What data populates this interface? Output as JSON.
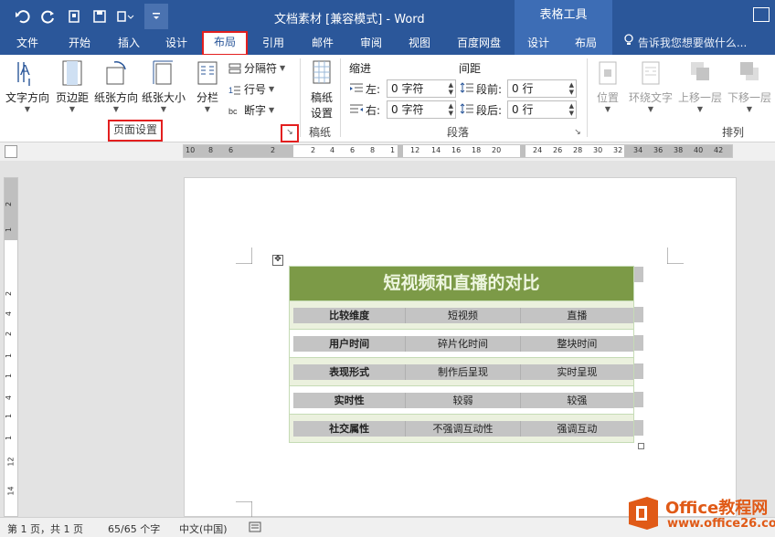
{
  "titlebar": {
    "title": "文档素材 [兼容模式] - Word",
    "context_tab_group": "表格工具",
    "qat_more": "="
  },
  "tabs": [
    {
      "label": "文件",
      "active": false
    },
    {
      "label": "开始",
      "active": false
    },
    {
      "label": "插入",
      "active": false
    },
    {
      "label": "设计",
      "active": false
    },
    {
      "label": "布局",
      "active": true
    },
    {
      "label": "引用",
      "active": false
    },
    {
      "label": "邮件",
      "active": false
    },
    {
      "label": "审阅",
      "active": false
    },
    {
      "label": "视图",
      "active": false
    },
    {
      "label": "百度网盘",
      "active": false
    },
    {
      "label": "设计",
      "active": false
    },
    {
      "label": "布局",
      "active": false
    }
  ],
  "tellme": "告诉我您想要做什么...",
  "ribbon": {
    "page_setup": {
      "text_direction": "文字方向",
      "margins": "页边距",
      "orientation": "纸张方向",
      "size": "纸张大小",
      "columns": "分栏",
      "breaks": "分隔符",
      "line_numbers": "行号",
      "hyphenation": "断字",
      "label": "页面设置",
      "launcher": "↘"
    },
    "manuscript": {
      "button_line1": "稿纸",
      "button_line2": "设置",
      "label": "稿纸"
    },
    "paragraph": {
      "indent_title": "缩进",
      "spacing_title": "间距",
      "left_label": "左:",
      "right_label": "右:",
      "before_label": "段前:",
      "after_label": "段后:",
      "left_value": "0 字符",
      "right_value": "0 字符",
      "before_value": "0 行",
      "after_value": "0 行",
      "label": "段落"
    },
    "arrange": {
      "position": "位置",
      "wrap_text": "环绕文字",
      "bring_forward": "上移一层",
      "send_backward": "下移一层",
      "label": "排列"
    }
  },
  "hruler_ticks": [
    "10",
    "8",
    "6",
    "2",
    "2",
    "4",
    "6",
    "8",
    "1",
    "12",
    "14",
    "16",
    "18",
    "20",
    "24",
    "26",
    "28",
    "30",
    "32",
    "34",
    "36",
    "38",
    "40",
    "42"
  ],
  "vruler_ticks": [
    "2",
    "1",
    "2",
    "4",
    "2",
    "1",
    "1",
    "4",
    "1",
    "1",
    "12",
    "14"
  ],
  "table": {
    "title": "短视频和直播的对比",
    "rows": [
      [
        "比较维度",
        "短视频",
        "直播"
      ],
      [
        "用户时间",
        "碎片化时间",
        "整块时间"
      ],
      [
        "表现形式",
        "制作后呈现",
        "实时呈现"
      ],
      [
        "实时性",
        "较弱",
        "较强"
      ],
      [
        "社交属性",
        "不强调互动性",
        "强调互动"
      ]
    ]
  },
  "status": {
    "page": "第 1 页，共 1 页",
    "words": "65/65 个字",
    "language": "中文(中国)"
  },
  "watermark": {
    "line1": "Office教程网",
    "line2": "www.office26.com"
  },
  "colors": {
    "brand_blue": "#2b579a",
    "table_header_green": "#7c9a47",
    "highlight_red": "#e31f1f",
    "watermark_orange": "#e05a17"
  }
}
